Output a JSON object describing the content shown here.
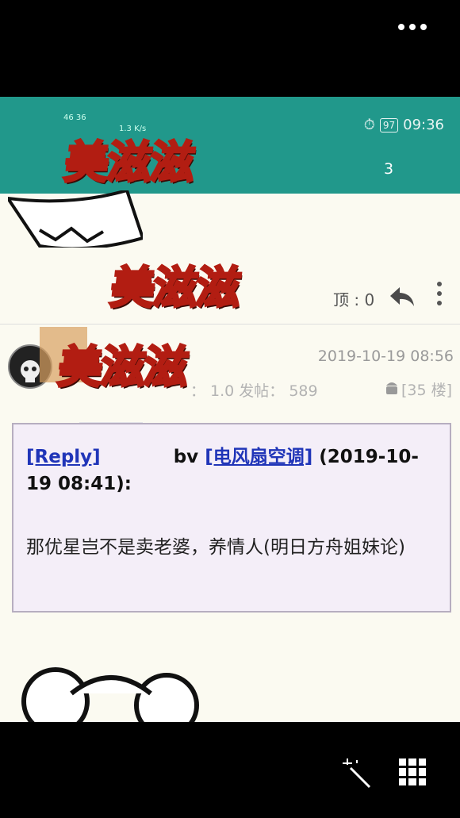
{
  "status": {
    "network": "46 36",
    "speed": "1.3 K/s",
    "battery": "97",
    "time": "09:36"
  },
  "tab_count": "3",
  "stickers": [
    "美滋滋",
    "美滋滋",
    "美滋滋"
  ],
  "toolbar": {
    "ding_label": "顶 : 0"
  },
  "post": {
    "date": "2019-10-19 08:56",
    "meta": "： 1.0  发帖： 589",
    "floor": "[35 楼]"
  },
  "quote": {
    "reply_tag": "[Reply]",
    "user_suffix": "bv",
    "forum_tag": "[电风扇空调]",
    "time": "(2019-10-19 08:41):",
    "body": "那优星岂不是卖老婆，养情人(明日方舟姐妹论)"
  },
  "colors": {
    "status_bar": "#21988b",
    "sticker": "#f8cc16",
    "link": "#2035b8"
  }
}
